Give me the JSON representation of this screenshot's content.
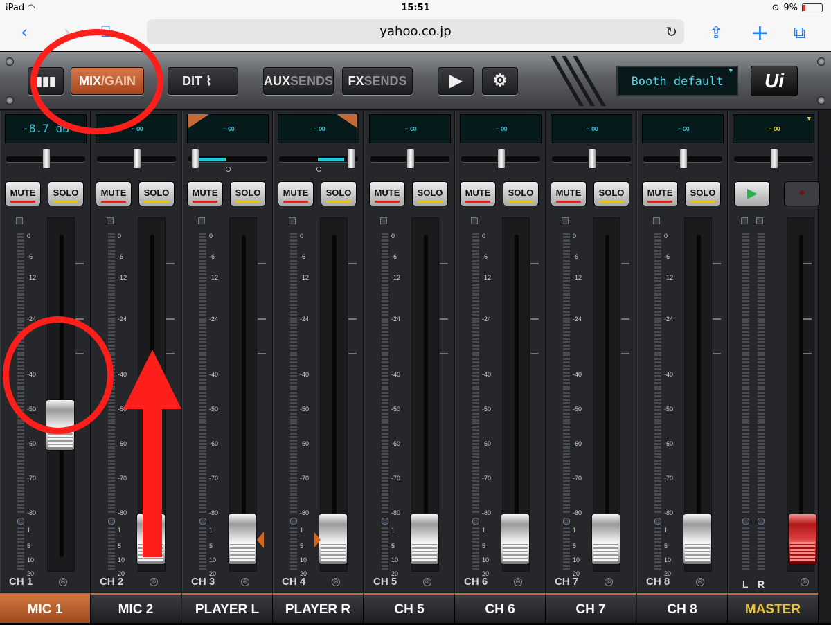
{
  "status": {
    "device": "iPad",
    "time": "15:51",
    "battery": "9%"
  },
  "browser": {
    "url": "yahoo.co.jp"
  },
  "toolbar": {
    "mix_label": "MIX",
    "gain_label": "/GAIN",
    "edit_label": "DIT",
    "aux_label": "AUX",
    "aux_sends": "SENDS",
    "fx_label": "FX",
    "fx_sends": "SENDS",
    "preset": "Booth default",
    "logo": "Ui"
  },
  "colors": {
    "accent": "#c56a34",
    "readout": "#38c7dc",
    "master": "#e5c33b",
    "annotation": "#ff1f1a"
  },
  "scale_labels": [
    "0",
    "-6",
    "-12",
    "-24",
    "-40",
    "-50",
    "-60",
    "-70",
    "-80",
    "1",
    "5",
    "10",
    "20"
  ],
  "strips": {
    "mute_label": "MUTE",
    "solo_label": "SOLO",
    "channels": [
      {
        "id": "CH 1",
        "name": "MIC 1",
        "readout": "-8.7 dB",
        "level": 0.47,
        "selected": true
      },
      {
        "id": "CH 2",
        "name": "MIC 2",
        "readout": "-∞",
        "level": 0.0
      },
      {
        "id": "CH 3",
        "name": "PLAYER L",
        "readout": "-∞",
        "level": 0.0,
        "pan_fill": "left"
      },
      {
        "id": "CH 4",
        "name": "PLAYER R",
        "readout": "-∞",
        "level": 0.0,
        "pan_fill": "right"
      },
      {
        "id": "CH 5",
        "name": "CH 5",
        "readout": "-∞",
        "level": 0.0
      },
      {
        "id": "CH 6",
        "name": "CH 6",
        "readout": "-∞",
        "level": 0.0
      },
      {
        "id": "CH 7",
        "name": "CH 7",
        "readout": "-∞",
        "level": 0.0
      },
      {
        "id": "CH 8",
        "name": "CH 8",
        "readout": "-∞",
        "level": 0.0
      }
    ],
    "master": {
      "name": "MASTER",
      "readout": "-∞",
      "left": "L",
      "right": "R",
      "level": 0.0
    }
  }
}
